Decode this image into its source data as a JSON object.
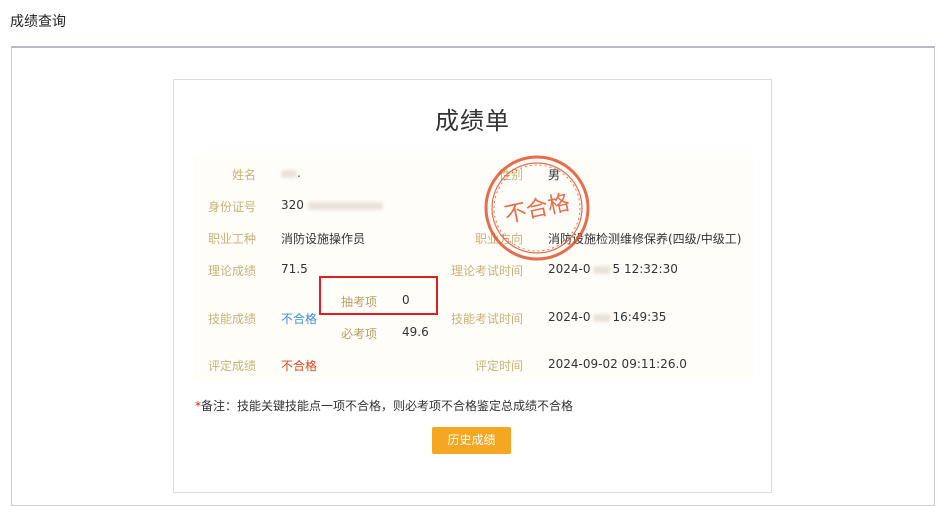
{
  "page": {
    "title": "成绩查询"
  },
  "report": {
    "title": "成绩单",
    "stamp_text": "不合格",
    "fields": {
      "name_label": "姓名",
      "name_value": ".",
      "gender_label": "性别",
      "gender_value": "男",
      "id_label": "身份证号",
      "id_value": "320",
      "job_label": "职业工种",
      "job_value": "消防设施操作员",
      "direction_label": "职业方向",
      "direction_value": "消防设施检测维修保养(四级/中级工)",
      "theory_label": "理论成绩",
      "theory_value": "71.5",
      "theory_time_label": "理论考试时间",
      "theory_time_value_a": "2024-0",
      "theory_time_value_b": "5 12:32:30",
      "skill_label": "技能成绩",
      "skill_value": "不合格",
      "sampled_label": "抽考项",
      "sampled_value": "0",
      "required_label": "必考项",
      "required_value": "49.6",
      "skill_time_label": "技能考试时间",
      "skill_time_value_a": "2024-0",
      "skill_time_value_b": "16:49:35",
      "eval_label": "评定成绩",
      "eval_value": "不合格",
      "eval_time_label": "评定时间",
      "eval_time_value": "2024-09-02 09:11:26.0"
    },
    "note_star": "*",
    "note_text": "备注：技能关键技能点一项不合格，则必考项不合格鉴定总成绩不合格",
    "history_button": "历史成绩"
  },
  "colors": {
    "accent": "#f5a623",
    "highlight": "#e02020",
    "label": "#c8b27a",
    "fail": "#e0461e",
    "link": "#3a8fe0"
  }
}
